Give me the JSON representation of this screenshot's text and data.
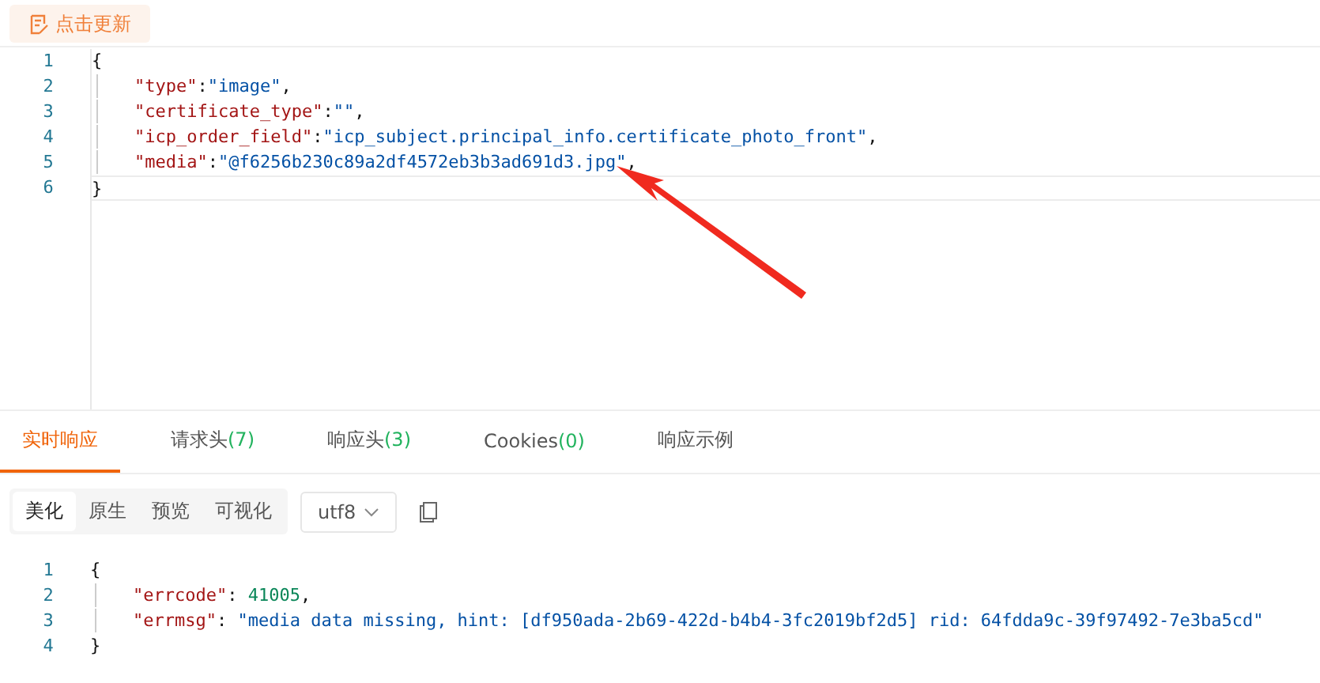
{
  "update_button": {
    "label": "点击更新"
  },
  "request_editor": {
    "lines": [
      {
        "number": "1",
        "tokens": [
          {
            "kind": "punct",
            "text": "{"
          }
        ],
        "children": [
          {
            "number": "2",
            "tokens": [
              {
                "kind": "key",
                "text": "\"type\""
              },
              {
                "kind": "punct",
                "text": ":"
              },
              {
                "kind": "string",
                "text": "\"image\""
              },
              {
                "kind": "punct",
                "text": ","
              }
            ]
          },
          {
            "number": "3",
            "tokens": [
              {
                "kind": "key",
                "text": "\"certificate_type\""
              },
              {
                "kind": "punct",
                "text": ":"
              },
              {
                "kind": "string",
                "text": "\"\""
              },
              {
                "kind": "punct",
                "text": ","
              }
            ]
          },
          {
            "number": "4",
            "tokens": [
              {
                "kind": "key",
                "text": "\"icp_order_field\""
              },
              {
                "kind": "punct",
                "text": ":"
              },
              {
                "kind": "string",
                "text": "\"icp_subject.principal_info.certificate_photo_front\""
              },
              {
                "kind": "punct",
                "text": ","
              }
            ]
          },
          {
            "number": "5",
            "tokens": [
              {
                "kind": "key",
                "text": "\"media\""
              },
              {
                "kind": "punct",
                "text": ":"
              },
              {
                "kind": "string",
                "text": "\"@f6256b230c89a2df4572eb3b3ad691d3.jpg\""
              },
              {
                "kind": "punct",
                "text": ","
              }
            ]
          }
        ]
      },
      {
        "number": "6",
        "tokens": [
          {
            "kind": "punct",
            "text": "}"
          }
        ],
        "active": true
      }
    ]
  },
  "response_tabs": [
    {
      "label": "实时响应",
      "selected": true
    },
    {
      "label": "请求头",
      "count": "(7)",
      "selected": false
    },
    {
      "label": "响应头",
      "count": "(3)",
      "selected": false
    },
    {
      "label": "Cookies",
      "count": "(0)",
      "selected": false
    },
    {
      "label": "响应示例",
      "selected": false
    }
  ],
  "view_modes": [
    {
      "label": "美化",
      "selected": true
    },
    {
      "label": "原生",
      "selected": false
    },
    {
      "label": "预览",
      "selected": false
    },
    {
      "label": "可视化",
      "selected": false
    }
  ],
  "encoding": {
    "value": "utf8"
  },
  "response_editor": {
    "lines": [
      {
        "number": "1",
        "tokens": [
          {
            "kind": "punct",
            "text": "{"
          }
        ],
        "children": [
          {
            "number": "2",
            "tokens": [
              {
                "kind": "key",
                "text": "\"errcode\""
              },
              {
                "kind": "punct",
                "text": ": "
              },
              {
                "kind": "number",
                "text": "41005"
              },
              {
                "kind": "punct",
                "text": ","
              }
            ]
          },
          {
            "number": "3",
            "tokens": [
              {
                "kind": "key",
                "text": "\"errmsg\""
              },
              {
                "kind": "punct",
                "text": ": "
              },
              {
                "kind": "string",
                "text": "\"media data missing, hint: [df950ada-2b69-422d-b4b4-3fc2019bf2d5] rid: 64fdda9c-39f97492-7e3ba5cd\""
              }
            ]
          }
        ]
      },
      {
        "number": "4",
        "tokens": [
          {
            "kind": "punct",
            "text": "}"
          }
        ]
      }
    ]
  }
}
